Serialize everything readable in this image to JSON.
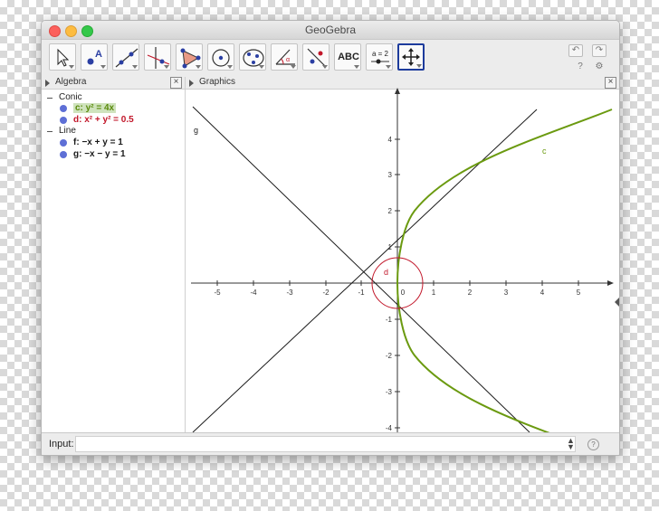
{
  "window": {
    "title": "GeoGebra"
  },
  "toolbar": {
    "tools": [
      {
        "name": "move-tool",
        "icon": "pointer-arrow-icon"
      },
      {
        "name": "point-tool",
        "icon": "point-a-icon"
      },
      {
        "name": "line-tool",
        "icon": "line-through-two-points-icon"
      },
      {
        "name": "perpendicular-line-tool",
        "icon": "perpendicular-line-icon"
      },
      {
        "name": "polygon-tool",
        "icon": "polygon-icon"
      },
      {
        "name": "circle-tool",
        "icon": "circle-center-point-icon"
      },
      {
        "name": "conic-tool",
        "icon": "ellipse-icon"
      },
      {
        "name": "angle-tool",
        "icon": "angle-icon"
      },
      {
        "name": "reflect-tool",
        "icon": "reflect-about-line-icon"
      },
      {
        "name": "text-tool",
        "label": "ABC"
      },
      {
        "name": "slider-tool",
        "label": "a = 2"
      },
      {
        "name": "move-graphics-view-tool",
        "icon": "move-graphics-view-icon"
      }
    ],
    "help_label": "?",
    "undo_glyph": "↶",
    "redo_glyph": "↷",
    "settings_glyph": "⚙"
  },
  "algebra": {
    "title": "Algebra",
    "close_glyph": "×",
    "categories": [
      {
        "label": "Conic",
        "items": [
          {
            "text": "c: y² = 4x",
            "color": "#5a8a0b"
          },
          {
            "text": "d: x² + y² = 0.5",
            "color": "#c2172a"
          }
        ]
      },
      {
        "label": "Line",
        "items": [
          {
            "text": "f: −x + y = 1",
            "color": "#1a1a1a"
          },
          {
            "text": "g: −x − y = 1",
            "color": "#1a1a1a"
          }
        ]
      }
    ],
    "dot_color": "#5e6fd6"
  },
  "graphics": {
    "title": "Graphics",
    "close_glyph": "×",
    "x_tick_labels": [
      "-5",
      "-4",
      "-3",
      "-2",
      "-1",
      "0",
      "1",
      "2",
      "3",
      "4",
      "5"
    ],
    "y_tick_labels": [
      "4",
      "3",
      "2",
      "1",
      "-1",
      "-2",
      "-3",
      "-4"
    ],
    "object_labels": {
      "c": "c",
      "d": "d",
      "f": "f",
      "g": "g"
    },
    "colors": {
      "parabola": "#6b9a10",
      "circle": "#c2172a",
      "lines": "#1a1a1a"
    }
  },
  "input_bar": {
    "label": "Input:",
    "value": "",
    "placeholder": "",
    "help_glyph": "?"
  }
}
